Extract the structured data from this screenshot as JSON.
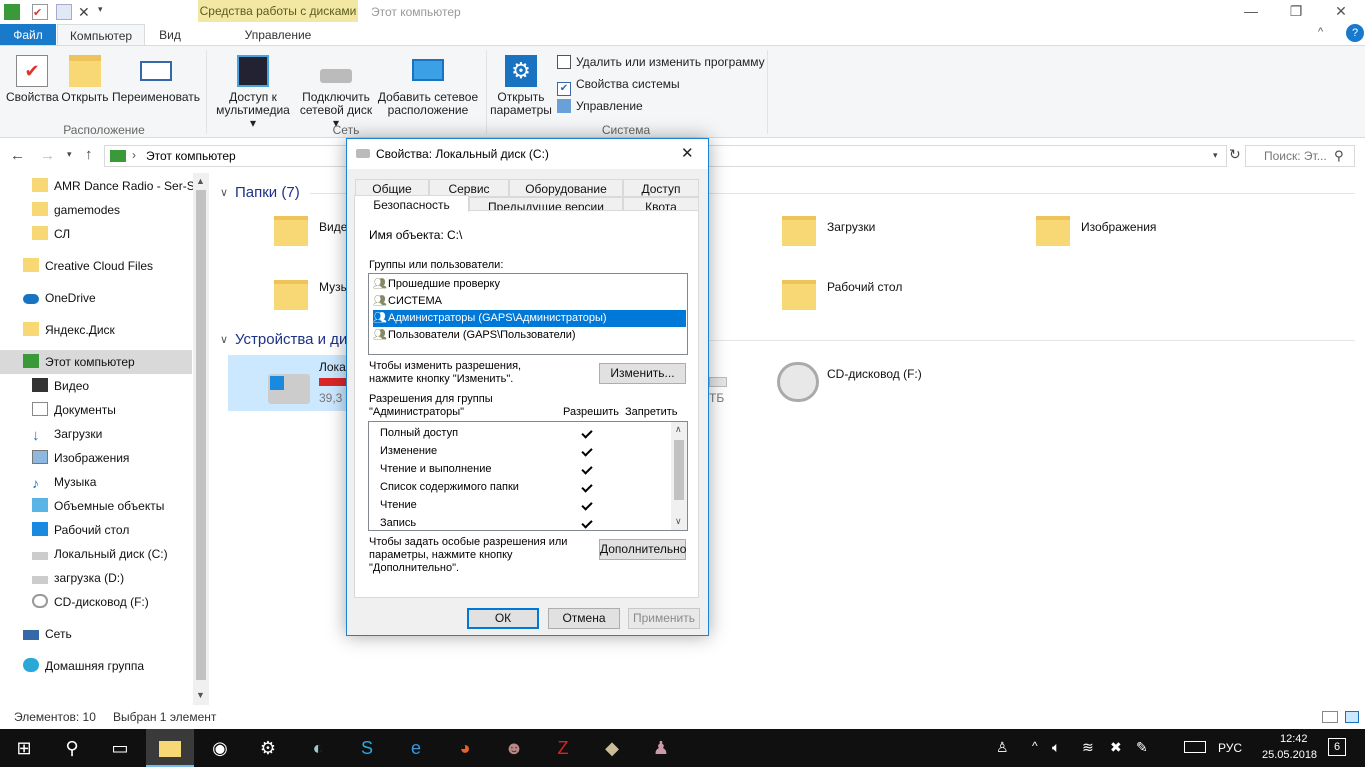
{
  "window": {
    "title": "Этот компьютер",
    "context_tab": "Средства работы с дисками",
    "minimize": "—",
    "maximize": "❐",
    "close": "✕",
    "help": "?",
    "collapse": "^"
  },
  "ribbon_tabs": {
    "file": "Файл",
    "computer": "Компьютер",
    "view": "Вид",
    "manage": "Управление"
  },
  "ribbon": {
    "properties": "Свойства",
    "open": "Открыть",
    "rename": "Переименовать",
    "group_location": "Расположение",
    "media_access_1": "Доступ к",
    "media_access_2": "мультимедиа",
    "map_drive_1": "Подключить",
    "map_drive_2": "сетевой диск",
    "add_location_1": "Добавить сетевое",
    "add_location_2": "расположение",
    "group_network": "Сеть",
    "open_settings_1": "Открыть",
    "open_settings_2": "параметры",
    "uninstall": "Удалить или изменить программу",
    "system_props": "Свойства системы",
    "manage": "Управление",
    "group_system": "Система"
  },
  "address": {
    "path": "Этот компьютер",
    "search_placeholder": "Поиск: Эт..."
  },
  "nav": {
    "items": [
      "AMR Dance Radio - Ser-S_t",
      "gamemodes",
      "СЛ",
      "Creative Cloud Files",
      "OneDrive",
      "Яндекс.Диск",
      "Этот компьютер",
      "Видео",
      "Документы",
      "Загрузки",
      "Изображения",
      "Музыка",
      "Объемные объекты",
      "Рабочий стол",
      "Локальный диск (C:)",
      "загрузка (D:)",
      "CD-дисковод (F:)",
      "Сеть",
      "Домашняя группа"
    ]
  },
  "content": {
    "folders_header": "Папки (7)",
    "devices_header": "Устройства и ди",
    "video": "Виде",
    "music": "Музы",
    "downloads": "Загрузки",
    "images": "Изображения",
    "desktop": "Рабочий стол",
    "local_disk": "Лока",
    "local_disk_free": "39,3 Г",
    "other_disk_size": "ТБ",
    "cd_drive": "CD-дисковод (F:)"
  },
  "status": {
    "count": "Элементов: 10",
    "selected": "Выбран 1 элемент"
  },
  "dialog": {
    "title": "Свойства: Локальный диск (C:)",
    "close": "✕",
    "tabs_row1": [
      "Общие",
      "Сервис",
      "Оборудование",
      "Доступ"
    ],
    "tabs_row2": [
      "Безопасность",
      "Предыдущие версии",
      "Квота"
    ],
    "object_label": "Имя объекта:",
    "object_value": "C:\\",
    "groups_label": "Группы или пользователи:",
    "groups": [
      "Прошедшие проверку",
      "СИСТЕМА",
      "Администраторы (GAPS\\Администраторы)",
      "Пользователи (GAPS\\Пользователи)"
    ],
    "change_hint_1": "Чтобы изменить разрешения,",
    "change_hint_2": "нажмите кнопку \"Изменить\".",
    "change_button": "Изменить...",
    "perms_for_1": "Разрешения для группы",
    "perms_for_2": "\"Администраторы\"",
    "allow": "Разрешить",
    "deny": "Запретить",
    "permissions": [
      "Полный доступ",
      "Изменение",
      "Чтение и выполнение",
      "Список содержимого папки",
      "Чтение",
      "Запись"
    ],
    "adv_hint_1": "Чтобы задать особые разрешения или",
    "adv_hint_2": "параметры, нажмите кнопку",
    "adv_hint_3": "\"Дополнительно\".",
    "advanced_button": "Дополнительно",
    "ok": "ОК",
    "cancel": "Отмена",
    "apply": "Применить"
  },
  "taskbar": {
    "lang": "РУС",
    "time": "12:42",
    "date": "25.05.2018",
    "notifications": "6"
  },
  "colors": {
    "accent": "#1979ca",
    "selection": "#0078d7",
    "context_tab": "#f3e8a3",
    "taskbar": "#101010"
  }
}
